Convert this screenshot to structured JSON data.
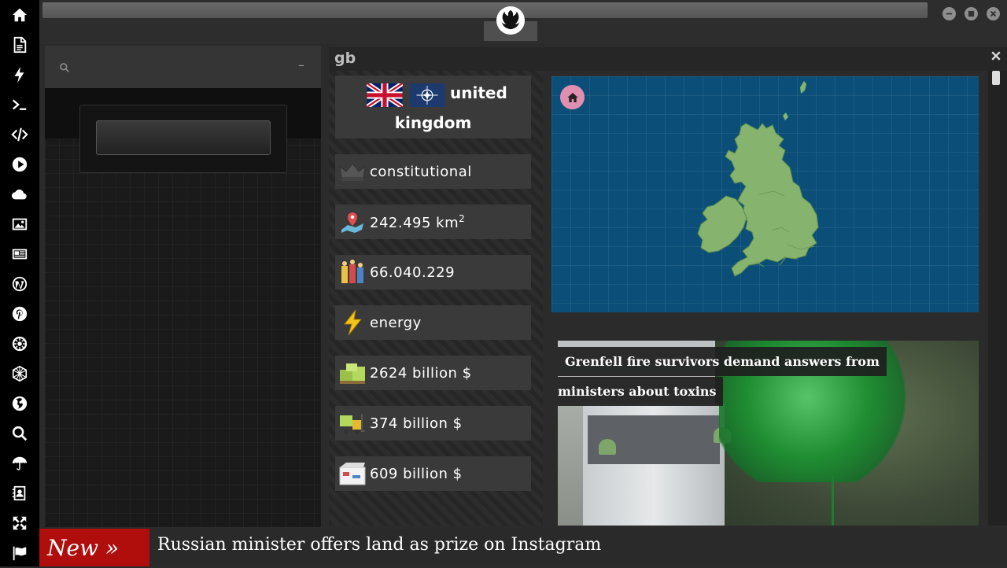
{
  "sidebar": {
    "items": [
      {
        "icon": "home-icon"
      },
      {
        "icon": "document-icon"
      },
      {
        "icon": "lightning-icon"
      },
      {
        "icon": "terminal-icon"
      },
      {
        "icon": "code-icon"
      },
      {
        "icon": "play-icon"
      },
      {
        "icon": "cloud-icon"
      },
      {
        "icon": "image-icon"
      },
      {
        "icon": "newspaper-icon"
      },
      {
        "icon": "wordpress-icon"
      },
      {
        "icon": "pinterest-icon"
      },
      {
        "icon": "atom-icon"
      },
      {
        "icon": "globe-grid-icon"
      },
      {
        "icon": "globe-icon"
      },
      {
        "icon": "search-icon"
      },
      {
        "icon": "umbrella-icon"
      },
      {
        "icon": "contact-icon"
      },
      {
        "icon": "expand-icon"
      },
      {
        "icon": "flag-icon"
      }
    ]
  },
  "topbar": {
    "logo": "rebel-alliance-icon",
    "buttons": [
      "minimize-icon",
      "maximize-icon",
      "close-icon"
    ]
  },
  "left_panel": {
    "search": {
      "placeholder": "",
      "value": ""
    },
    "collapse_label": "–"
  },
  "detail": {
    "title": "gb",
    "country": {
      "name_line1": "united",
      "name_line2": "kingdom",
      "flags": [
        "uk-flag",
        "nato-flag"
      ]
    },
    "facts": [
      {
        "icon": "crown-icon",
        "text": "constitutional"
      },
      {
        "icon": "map-pin-icon",
        "text": "242.495 km",
        "sup": "2"
      },
      {
        "icon": "people-icon",
        "text": "66.040.229"
      },
      {
        "icon": "energy-icon",
        "text": "energy"
      },
      {
        "icon": "gdp-icon",
        "text": "2624 billion $"
      },
      {
        "icon": "forklift-icon",
        "text": "374 billion $"
      },
      {
        "icon": "boxes-icon",
        "text": "609 billion $"
      }
    ],
    "map": {
      "home_icon": "home-icon",
      "land_color": "#86b46f",
      "sea_color": "#0b4f79"
    },
    "news": {
      "headline_line1": "Grenfell fire survivors demand answers from",
      "headline_line2": "ministers about toxins"
    }
  },
  "ticker": {
    "label": "New »",
    "text": "Russian minister offers land as prize on Instagram"
  }
}
